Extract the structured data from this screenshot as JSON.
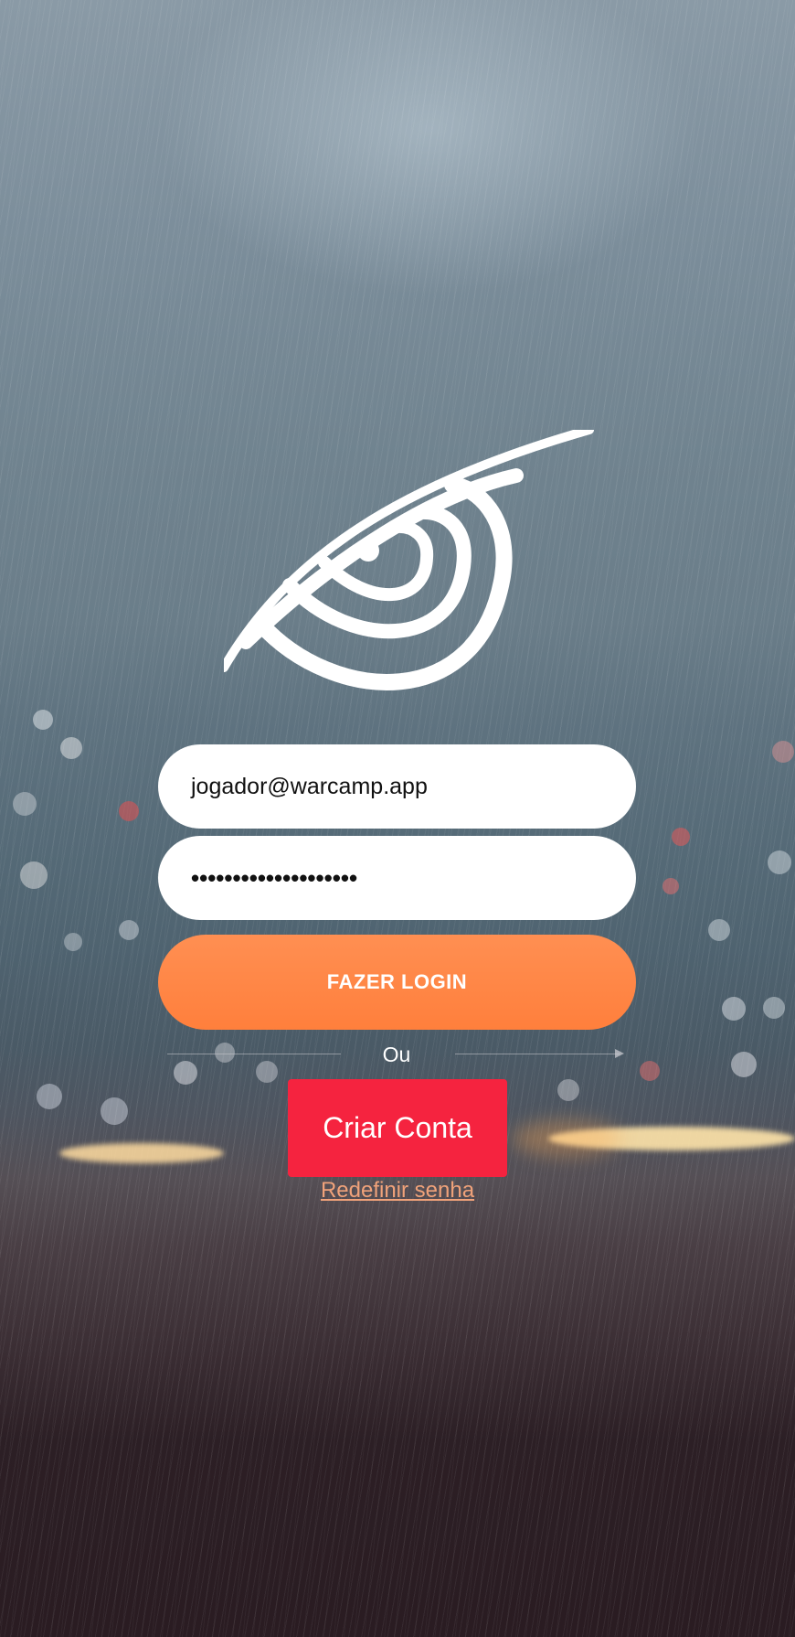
{
  "login": {
    "email_value": "jogador@warcamp.app",
    "password_value": "••••••••••••••••••••",
    "login_button_label": "FAZER LOGIN",
    "divider_label": "Ou",
    "create_account_label": "Criar Conta",
    "reset_password_label": "Redefinir senha"
  },
  "icons": {
    "logo": "eye-logo-icon"
  },
  "colors": {
    "login_button": "#ff8747",
    "create_account_button": "#f5233f",
    "reset_link": "#f0a27a",
    "field_background": "#ffffff"
  }
}
